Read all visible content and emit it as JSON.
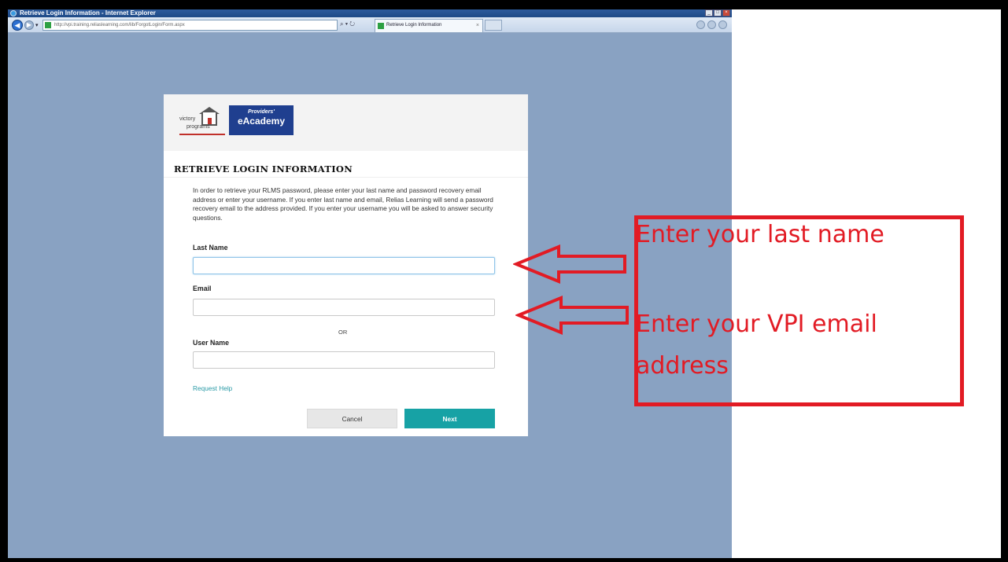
{
  "window": {
    "title": "Retrieve Login Information - Internet Explorer",
    "address": "http://vpi.training.reliaslearning.com/lib/ForgotLogin/Form.aspx",
    "tab_label": "Retrieve Login Information"
  },
  "logos": {
    "vp_line1": "victory",
    "vp_line2": "programs",
    "pa_line1": "Providers'",
    "pa_line2": "eAcademy"
  },
  "dialog": {
    "title": "RETRIEVE LOGIN INFORMATION",
    "intro": "In order to retrieve your RLMS password, please enter your last name and password recovery email address or enter your username. If you enter last name and email, Relias Learning will send a password recovery email to the address provided. If you enter your username you will be asked to answer security questions.",
    "last_name_label": "Last Name",
    "last_name_value": "",
    "email_label": "Email",
    "email_value": "",
    "or_text": "OR",
    "username_label": "User Name",
    "username_value": "",
    "help_link": "Request Help",
    "cancel_label": "Cancel",
    "next_label": "Next"
  },
  "annotations": {
    "note1": "Enter your last name",
    "note2_line1": "Enter your VPI email",
    "note2_line2": "address",
    "color": "#e21b24"
  },
  "colors": {
    "page_background": "#89a2c2",
    "accent_button": "#17a2a5",
    "link": "#2a9aa6"
  }
}
